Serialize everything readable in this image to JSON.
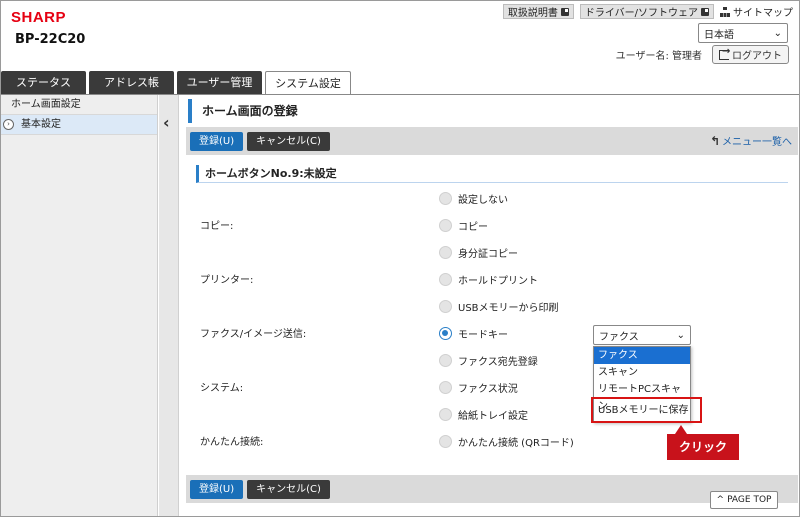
{
  "header": {
    "logo": "SHARP",
    "model": "BP-22C20",
    "links": [
      "取扱説明書",
      "ドライバー/ソフトウェア"
    ],
    "sitemap": "サイトマップ",
    "language": "日本語",
    "user_label": "ユーザー名: 管理者",
    "logout": "ログアウト"
  },
  "tabs": [
    {
      "label": "ステータス",
      "active": false
    },
    {
      "label": "アドレス帳",
      "active": false
    },
    {
      "label": "ユーザー管理",
      "active": false
    },
    {
      "label": "システム設定",
      "active": true
    }
  ],
  "sidebar": {
    "items": [
      {
        "label": "ホーム画面設定",
        "active": false
      },
      {
        "label": "基本設定",
        "active": true
      }
    ]
  },
  "main": {
    "title": "ホーム画面の登録",
    "register_button": "登録(U)",
    "cancel_button": "キャンセル(C)",
    "menu_link": "メニュー一覧へ",
    "section_title": "ホームボタンNo.9:未設定",
    "rows": [
      {
        "label": "",
        "option": "設定しない",
        "checked": false
      },
      {
        "label": "コピー:",
        "option": "コピー",
        "checked": false
      },
      {
        "label": "",
        "option": "身分証コピー",
        "checked": false
      },
      {
        "label": "プリンター:",
        "option": "ホールドプリント",
        "checked": false
      },
      {
        "label": "",
        "option": "USBメモリーから印刷",
        "checked": false
      },
      {
        "label": "ファクス/イメージ送信:",
        "option": "モードキー",
        "checked": true
      },
      {
        "label": "",
        "option": "ファクス宛先登録",
        "checked": false
      },
      {
        "label": "システム:",
        "option": "ファクス状況",
        "checked": false
      },
      {
        "label": "",
        "option": "給紙トレイ設定",
        "checked": false
      },
      {
        "label": "かんたん接続:",
        "option": "かんたん接続 (QRコード)",
        "checked": false
      }
    ],
    "mode_select": {
      "value": "ファクス",
      "options": [
        "ファクス",
        "スキャン",
        "リモートPCスキャン",
        "USBメモリーに保存"
      ],
      "selected_index": 0
    },
    "callout": "クリック",
    "page_top": "PAGE TOP"
  },
  "colors": {
    "brand": "#e60012",
    "accent": "#2a7fc8",
    "primary_button": "#1a6fb8",
    "callout": "#c8121b"
  }
}
